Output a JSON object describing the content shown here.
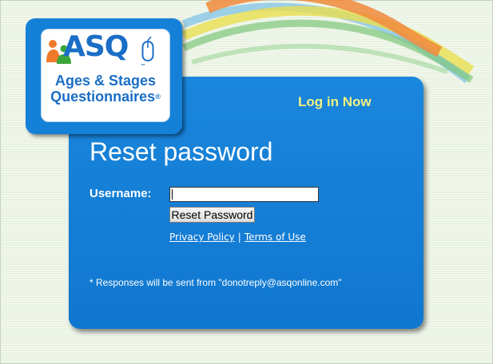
{
  "logo": {
    "word": "ASQ",
    "tm": "™",
    "line1": "Ages & Stages",
    "line2": "Questionnaires",
    "registered": "®"
  },
  "header": {
    "login_link": "Log in Now"
  },
  "form": {
    "title": "Reset password",
    "username_label": "Username:",
    "username_value": "",
    "reset_button": "Reset Password"
  },
  "links": {
    "privacy": "Privacy Policy",
    "separator": "|",
    "terms": "Terms of Use"
  },
  "footnote": "* Responses will be sent from \"donotreply@asqonline.com\"",
  "colors": {
    "panel_blue": "#1580d8",
    "login_yellow": "#f2f280",
    "logo_blue": "#1a6ec6",
    "figure_orange": "#f07a2a",
    "figure_green": "#3aa63a",
    "swoosh_orange": "#f08a3c",
    "swoosh_yellow": "#eadf50",
    "swoosh_green": "#7ec87a",
    "swoosh_blue": "#5ab0e6"
  }
}
